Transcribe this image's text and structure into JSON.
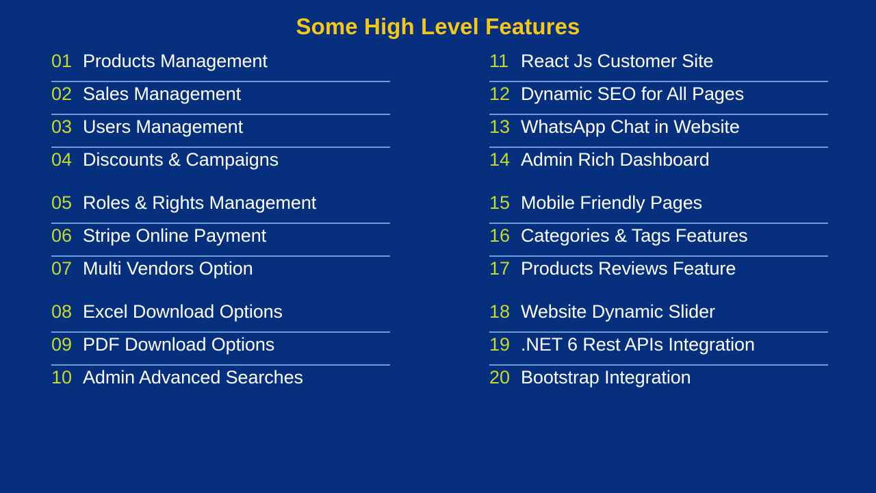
{
  "slide": {
    "title": "Some High Level Features",
    "background_color": "#06307e",
    "title_color": "#f5c71a",
    "number_color": "#c5d92d",
    "label_color": "#ffffff",
    "divider_color": "#6b9ed6"
  },
  "columns": [
    {
      "name": "left-column",
      "groups": [
        {
          "items": [
            {
              "number": "01",
              "label": "Products Management"
            },
            {
              "number": "02",
              "label": "Sales Management"
            },
            {
              "number": "03",
              "label": "Users Management"
            },
            {
              "number": "04",
              "label": "Discounts & Campaigns"
            }
          ]
        },
        {
          "items": [
            {
              "number": "05",
              "label": "Roles & Rights Management"
            },
            {
              "number": "06",
              "label": "Stripe Online Payment"
            },
            {
              "number": "07",
              "label": "Multi Vendors Option"
            }
          ]
        },
        {
          "items": [
            {
              "number": "08",
              "label": "Excel Download Options"
            },
            {
              "number": "09",
              "label": "PDF Download Options"
            },
            {
              "number": "10",
              "label": "Admin Advanced Searches"
            }
          ]
        }
      ]
    },
    {
      "name": "right-column",
      "groups": [
        {
          "items": [
            {
              "number": "11",
              "label": "React Js Customer Site"
            },
            {
              "number": "12",
              "label": "Dynamic SEO for All Pages"
            },
            {
              "number": "13",
              "label": "WhatsApp Chat in Website"
            },
            {
              "number": "14",
              "label": "Admin Rich Dashboard"
            }
          ]
        },
        {
          "items": [
            {
              "number": "15",
              "label": "Mobile Friendly Pages"
            },
            {
              "number": "16",
              "label": "Categories & Tags Features"
            },
            {
              "number": "17",
              "label": "Products Reviews Feature"
            }
          ]
        },
        {
          "items": [
            {
              "number": "18",
              "label": "Website Dynamic Slider"
            },
            {
              "number": "19",
              "label": ".NET 6 Rest APIs Integration"
            },
            {
              "number": "20",
              "label": "Bootstrap Integration"
            }
          ]
        }
      ]
    }
  ]
}
